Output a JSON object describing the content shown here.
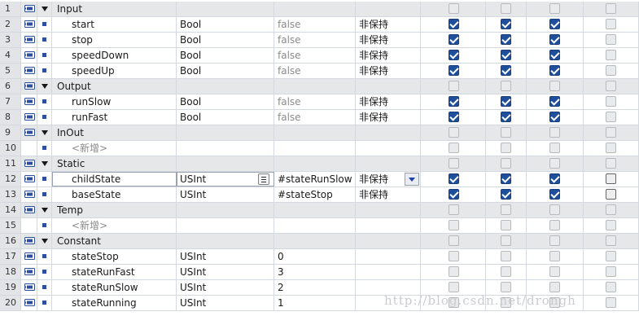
{
  "rows": [
    {
      "num": "1",
      "kind": "section",
      "name": "Input",
      "type": "",
      "default": "",
      "retain": "",
      "checks": [
        0,
        0,
        0,
        0
      ],
      "icon": "interface-tag-icon"
    },
    {
      "num": "2",
      "kind": "var",
      "name": "start",
      "type": "Bool",
      "default": "false",
      "retain": "非保持",
      "checks": [
        1,
        1,
        1,
        0
      ],
      "icon": "interface-tag-icon"
    },
    {
      "num": "3",
      "kind": "var",
      "name": "stop",
      "type": "Bool",
      "default": "false",
      "retain": "非保持",
      "checks": [
        1,
        1,
        1,
        0
      ],
      "icon": "interface-tag-icon"
    },
    {
      "num": "4",
      "kind": "var",
      "name": "speedDown",
      "type": "Bool",
      "default": "false",
      "retain": "非保持",
      "checks": [
        1,
        1,
        1,
        0
      ],
      "icon": "interface-tag-icon"
    },
    {
      "num": "5",
      "kind": "var",
      "name": "speedUp",
      "type": "Bool",
      "default": "false",
      "retain": "非保持",
      "checks": [
        1,
        1,
        1,
        0
      ],
      "icon": "interface-tag-icon"
    },
    {
      "num": "6",
      "kind": "section",
      "name": "Output",
      "type": "",
      "default": "",
      "retain": "",
      "checks": [
        0,
        0,
        0,
        0
      ],
      "icon": "interface-tag-icon"
    },
    {
      "num": "7",
      "kind": "var",
      "name": "runSlow",
      "type": "Bool",
      "default": "false",
      "retain": "非保持",
      "checks": [
        1,
        1,
        1,
        0
      ],
      "icon": "interface-tag-icon"
    },
    {
      "num": "8",
      "kind": "var",
      "name": "runFast",
      "type": "Bool",
      "default": "false",
      "retain": "非保持",
      "checks": [
        1,
        1,
        1,
        0
      ],
      "icon": "interface-tag-icon"
    },
    {
      "num": "9",
      "kind": "section",
      "name": "InOut",
      "type": "",
      "default": "",
      "retain": "",
      "checks": [
        0,
        0,
        0,
        0
      ],
      "icon": "interface-tag-icon"
    },
    {
      "num": "10",
      "kind": "add",
      "name": "<新增>",
      "type": "",
      "default": "",
      "retain": "",
      "checks": [
        0,
        0,
        0,
        0
      ],
      "icon": ""
    },
    {
      "num": "11",
      "kind": "section",
      "name": "Static",
      "type": "",
      "default": "",
      "retain": "",
      "checks": [
        0,
        0,
        0,
        0
      ],
      "icon": "interface-tag-icon"
    },
    {
      "num": "12",
      "kind": "var-sel",
      "name": "childState",
      "type": "USInt",
      "default": "#stateRunSlow",
      "retain": "非保持",
      "checks": [
        1,
        1,
        1,
        2
      ],
      "icon": "interface-tag-icon"
    },
    {
      "num": "13",
      "kind": "var",
      "name": "baseState",
      "type": "USInt",
      "default": "#stateStop",
      "retain": "非保持",
      "checks": [
        1,
        1,
        1,
        2
      ],
      "icon": "interface-tag-icon"
    },
    {
      "num": "14",
      "kind": "section",
      "name": "Temp",
      "type": "",
      "default": "",
      "retain": "",
      "checks": [
        0,
        0,
        0,
        0
      ],
      "icon": "interface-tag-icon"
    },
    {
      "num": "15",
      "kind": "add",
      "name": "<新增>",
      "type": "",
      "default": "",
      "retain": "",
      "checks": [
        0,
        0,
        0,
        0
      ],
      "icon": ""
    },
    {
      "num": "16",
      "kind": "section",
      "name": "Constant",
      "type": "",
      "default": "",
      "retain": "",
      "checks": [
        0,
        0,
        0,
        0
      ],
      "icon": "interface-tag-icon"
    },
    {
      "num": "17",
      "kind": "const",
      "name": "stateStop",
      "type": "USInt",
      "default": "0",
      "retain": "",
      "checks": [
        0,
        0,
        0,
        0
      ],
      "icon": "interface-tag-icon"
    },
    {
      "num": "18",
      "kind": "const",
      "name": "stateRunFast",
      "type": "USInt",
      "default": "3",
      "retain": "",
      "checks": [
        0,
        0,
        0,
        0
      ],
      "icon": "interface-tag-icon"
    },
    {
      "num": "19",
      "kind": "const",
      "name": "stateRunSlow",
      "type": "USInt",
      "default": "2",
      "retain": "",
      "checks": [
        0,
        0,
        0,
        0
      ],
      "icon": "interface-tag-icon"
    },
    {
      "num": "20",
      "kind": "const",
      "name": "stateRunning",
      "type": "USInt",
      "default": "1",
      "retain": "",
      "checks": [
        0,
        0,
        0,
        0
      ],
      "icon": "interface-tag-icon"
    }
  ],
  "watermark": "http://blog.csdn.net/drongh",
  "colors": {
    "checked": "#1f4f9c",
    "section_bg": "#e6e7e8",
    "tag_icon": "#2b4ea0"
  }
}
